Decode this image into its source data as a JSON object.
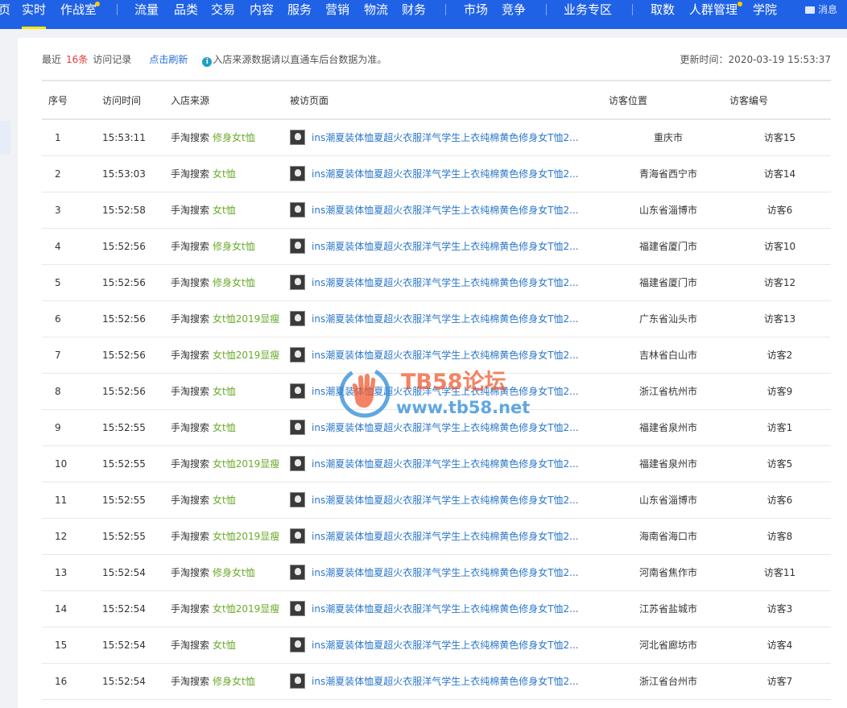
{
  "topnav": {
    "items": [
      {
        "label": "页"
      },
      {
        "label": "实时",
        "active": true
      },
      {
        "label": "作战室",
        "dot": true
      },
      {
        "label": "流量"
      },
      {
        "label": "品类"
      },
      {
        "label": "交易"
      },
      {
        "label": "内容"
      },
      {
        "label": "服务"
      },
      {
        "label": "营销"
      },
      {
        "label": "物流"
      },
      {
        "label": "财务"
      },
      {
        "label": "市场"
      },
      {
        "label": "竞争"
      },
      {
        "label": "业务专区"
      },
      {
        "label": "取数"
      },
      {
        "label": "人群管理",
        "dot": true
      },
      {
        "label": "学院"
      }
    ],
    "message_label": "消息"
  },
  "summary": {
    "prefix": "最近",
    "count": "16条",
    "suffix": "访问记录",
    "refresh_label": "点击刷新",
    "tip_icon": "i",
    "tip": "入店来源数据请以直通车后台数据为准。",
    "update_time": "更新时间：2020-03-19 15:53:37"
  },
  "table": {
    "headers": {
      "index": "序号",
      "time": "访问时间",
      "source": "入店来源",
      "page": "被访页面",
      "location": "访客位置",
      "visitor": "访客编号"
    },
    "rows": [
      {
        "index": "1",
        "time": "15:53:11",
        "source": "手淘搜索",
        "keyword": "修身女t恤",
        "page": "ins潮夏装体恤夏超火衣服洋气学生上衣纯棉黄色修身女T恤2...",
        "location": "重庆市",
        "visitor": "访客15"
      },
      {
        "index": "2",
        "time": "15:53:03",
        "source": "手淘搜索",
        "keyword": "女t恤",
        "page": "ins潮夏装体恤夏超火衣服洋气学生上衣纯棉黄色修身女T恤2...",
        "location": "青海省西宁市",
        "visitor": "访客14"
      },
      {
        "index": "3",
        "time": "15:52:58",
        "source": "手淘搜索",
        "keyword": "女t恤",
        "page": "ins潮夏装体恤夏超火衣服洋气学生上衣纯棉黄色修身女T恤2...",
        "location": "山东省淄博市",
        "visitor": "访客6"
      },
      {
        "index": "4",
        "time": "15:52:56",
        "source": "手淘搜索",
        "keyword": "修身女t恤",
        "page": "ins潮夏装体恤夏超火衣服洋气学生上衣纯棉黄色修身女T恤2...",
        "location": "福建省厦门市",
        "visitor": "访客10"
      },
      {
        "index": "5",
        "time": "15:52:56",
        "source": "手淘搜索",
        "keyword": "修身女t恤",
        "page": "ins潮夏装体恤夏超火衣服洋气学生上衣纯棉黄色修身女T恤2...",
        "location": "福建省厦门市",
        "visitor": "访客12"
      },
      {
        "index": "6",
        "time": "15:52:56",
        "source": "手淘搜索",
        "keyword": "女t恤2019显瘦",
        "page": "ins潮夏装体恤夏超火衣服洋气学生上衣纯棉黄色修身女T恤2...",
        "location": "广东省汕头市",
        "visitor": "访客13"
      },
      {
        "index": "7",
        "time": "15:52:56",
        "source": "手淘搜索",
        "keyword": "女t恤2019显瘦",
        "page": "ins潮夏装体恤夏超火衣服洋气学生上衣纯棉黄色修身女T恤2...",
        "location": "吉林省白山市",
        "visitor": "访客2"
      },
      {
        "index": "8",
        "time": "15:52:56",
        "source": "手淘搜索",
        "keyword": "女t恤",
        "page": "ins潮夏装体恤夏超火衣服洋气学生上衣纯棉黄色修身女T恤2...",
        "location": "浙江省杭州市",
        "visitor": "访客9"
      },
      {
        "index": "9",
        "time": "15:52:55",
        "source": "手淘搜索",
        "keyword": "女t恤",
        "page": "ins潮夏装体恤夏超火衣服洋气学生上衣纯棉黄色修身女T恤2...",
        "location": "福建省泉州市",
        "visitor": "访客1"
      },
      {
        "index": "10",
        "time": "15:52:55",
        "source": "手淘搜索",
        "keyword": "女t恤2019显瘦",
        "page": "ins潮夏装体恤夏超火衣服洋气学生上衣纯棉黄色修身女T恤2...",
        "location": "福建省泉州市",
        "visitor": "访客5"
      },
      {
        "index": "11",
        "time": "15:52:55",
        "source": "手淘搜索",
        "keyword": "女t恤",
        "page": "ins潮夏装体恤夏超火衣服洋气学生上衣纯棉黄色修身女T恤2...",
        "location": "山东省淄博市",
        "visitor": "访客6"
      },
      {
        "index": "12",
        "time": "15:52:55",
        "source": "手淘搜索",
        "keyword": "女t恤2019显瘦",
        "page": "ins潮夏装体恤夏超火衣服洋气学生上衣纯棉黄色修身女T恤2...",
        "location": "海南省海口市",
        "visitor": "访客8"
      },
      {
        "index": "13",
        "time": "15:52:54",
        "source": "手淘搜索",
        "keyword": "修身女t恤",
        "page": "ins潮夏装体恤夏超火衣服洋气学生上衣纯棉黄色修身女T恤2...",
        "location": "河南省焦作市",
        "visitor": "访客11"
      },
      {
        "index": "14",
        "time": "15:52:54",
        "source": "手淘搜索",
        "keyword": "女t恤2019显瘦",
        "page": "ins潮夏装体恤夏超火衣服洋气学生上衣纯棉黄色修身女T恤2...",
        "location": "江苏省盐城市",
        "visitor": "访客3"
      },
      {
        "index": "15",
        "time": "15:52:54",
        "source": "手淘搜索",
        "keyword": "女t恤",
        "page": "ins潮夏装体恤夏超火衣服洋气学生上衣纯棉黄色修身女T恤2...",
        "location": "河北省廊坊市",
        "visitor": "访客4"
      },
      {
        "index": "16",
        "time": "15:52:54",
        "source": "手淘搜索",
        "keyword": "修身女t恤",
        "page": "ins潮夏装体恤夏超火衣服洋气学生上衣纯棉黄色修身女T恤2...",
        "location": "浙江省台州市",
        "visitor": "访客7"
      }
    ]
  },
  "watermark": {
    "title": "TB58论坛",
    "url": "www.tb58.net"
  },
  "colors": {
    "nav_bg": "#2062e6",
    "active_underline": "#ffe600",
    "count_red": "#e4393c",
    "link_blue": "#2b77c9",
    "keyword_green": "#6aaa2a"
  }
}
